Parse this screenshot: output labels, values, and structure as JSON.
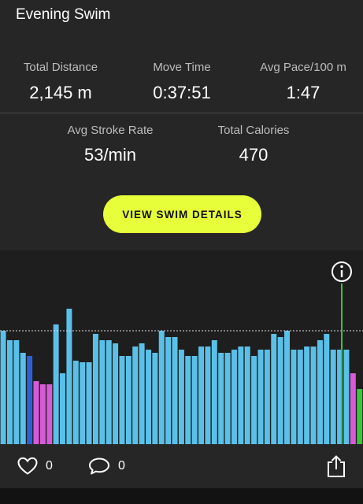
{
  "activity": {
    "title": "Evening Swim"
  },
  "stats": {
    "distance": {
      "label": "Total Distance",
      "value": "2,145 m"
    },
    "move_time": {
      "label": "Move Time",
      "value": "0:37:51"
    },
    "avg_pace": {
      "label": "Avg Pace/100 m",
      "value": "1:47"
    },
    "stroke_rate": {
      "label": "Avg Stroke Rate",
      "value": "53/min"
    },
    "calories": {
      "label": "Total Calories",
      "value": "470"
    }
  },
  "cta": {
    "label": "VIEW SWIM DETAILS"
  },
  "chart_data": {
    "type": "bar",
    "colors": {
      "freestyle": "#5bc0e8",
      "drill": "#d65bd6",
      "other": "#2f5fd6",
      "marker": "#3cc43c",
      "background": "#1e1e1e"
    },
    "reference_line": "dashed average line",
    "bars": [
      {
        "v": 0.72,
        "c": "freestyle"
      },
      {
        "v": 0.66,
        "c": "freestyle"
      },
      {
        "v": 0.66,
        "c": "freestyle"
      },
      {
        "v": 0.58,
        "c": "freestyle"
      },
      {
        "v": 0.56,
        "c": "other"
      },
      {
        "v": 0.4,
        "c": "drill"
      },
      {
        "v": 0.38,
        "c": "drill"
      },
      {
        "v": 0.38,
        "c": "drill"
      },
      {
        "v": 0.76,
        "c": "freestyle"
      },
      {
        "v": 0.45,
        "c": "freestyle"
      },
      {
        "v": 0.86,
        "c": "freestyle"
      },
      {
        "v": 0.53,
        "c": "freestyle"
      },
      {
        "v": 0.52,
        "c": "freestyle"
      },
      {
        "v": 0.52,
        "c": "freestyle"
      },
      {
        "v": 0.7,
        "c": "freestyle"
      },
      {
        "v": 0.66,
        "c": "freestyle"
      },
      {
        "v": 0.66,
        "c": "freestyle"
      },
      {
        "v": 0.64,
        "c": "freestyle"
      },
      {
        "v": 0.56,
        "c": "freestyle"
      },
      {
        "v": 0.56,
        "c": "freestyle"
      },
      {
        "v": 0.62,
        "c": "freestyle"
      },
      {
        "v": 0.64,
        "c": "freestyle"
      },
      {
        "v": 0.6,
        "c": "freestyle"
      },
      {
        "v": 0.58,
        "c": "freestyle"
      },
      {
        "v": 0.72,
        "c": "freestyle"
      },
      {
        "v": 0.68,
        "c": "freestyle"
      },
      {
        "v": 0.68,
        "c": "freestyle"
      },
      {
        "v": 0.6,
        "c": "freestyle"
      },
      {
        "v": 0.56,
        "c": "freestyle"
      },
      {
        "v": 0.56,
        "c": "freestyle"
      },
      {
        "v": 0.62,
        "c": "freestyle"
      },
      {
        "v": 0.62,
        "c": "freestyle"
      },
      {
        "v": 0.66,
        "c": "freestyle"
      },
      {
        "v": 0.58,
        "c": "freestyle"
      },
      {
        "v": 0.58,
        "c": "freestyle"
      },
      {
        "v": 0.6,
        "c": "freestyle"
      },
      {
        "v": 0.62,
        "c": "freestyle"
      },
      {
        "v": 0.62,
        "c": "freestyle"
      },
      {
        "v": 0.56,
        "c": "freestyle"
      },
      {
        "v": 0.6,
        "c": "freestyle"
      },
      {
        "v": 0.6,
        "c": "freestyle"
      },
      {
        "v": 0.7,
        "c": "freestyle"
      },
      {
        "v": 0.68,
        "c": "freestyle"
      },
      {
        "v": 0.72,
        "c": "freestyle"
      },
      {
        "v": 0.6,
        "c": "freestyle"
      },
      {
        "v": 0.6,
        "c": "freestyle"
      },
      {
        "v": 0.62,
        "c": "freestyle"
      },
      {
        "v": 0.62,
        "c": "freestyle"
      },
      {
        "v": 0.66,
        "c": "freestyle"
      },
      {
        "v": 0.7,
        "c": "freestyle"
      },
      {
        "v": 0.6,
        "c": "freestyle"
      },
      {
        "v": 0.6,
        "c": "freestyle"
      },
      {
        "v": 0.6,
        "c": "freestyle"
      },
      {
        "v": 0.45,
        "c": "drill"
      },
      {
        "v": 0.35,
        "c": "marker"
      }
    ]
  },
  "footer": {
    "like_count": "0",
    "comment_count": "0",
    "icons": [
      "heart-icon",
      "comment-icon",
      "share-icon"
    ]
  }
}
